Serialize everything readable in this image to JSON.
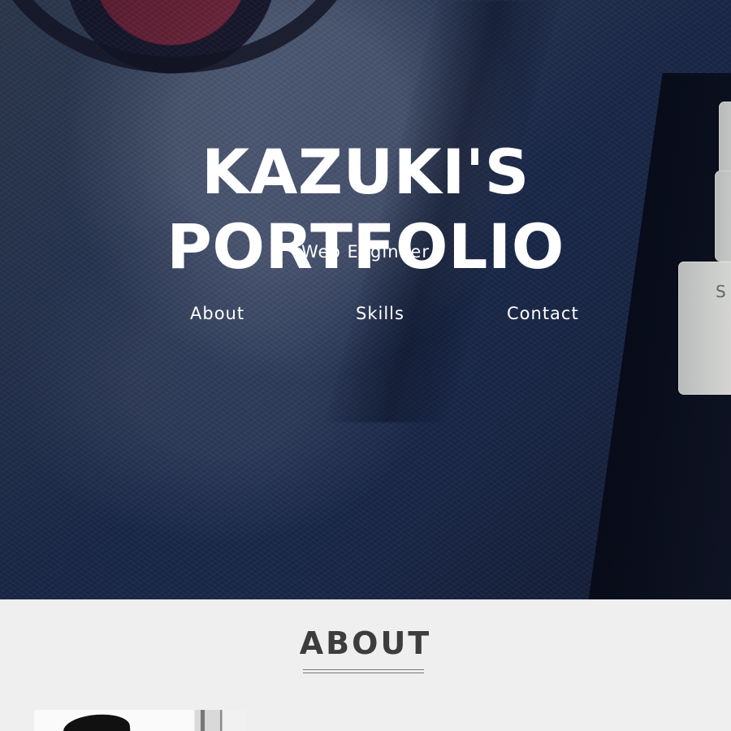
{
  "hero": {
    "title": "KAZUKI'S PORTFOLIO",
    "subtitle": "Web Engineer",
    "background_description": "dark blue textured background with keyboard keys"
  },
  "navigation": {
    "items": [
      {
        "label": "About"
      },
      {
        "label": "Skills"
      },
      {
        "label": "Contact"
      }
    ]
  },
  "about": {
    "title": "ABOUT",
    "photo_alt": "profile photo"
  },
  "visual": {
    "hero_text_color": "#ffffff",
    "section_background": "#efeff0",
    "heading_color": "#3d3d3d",
    "divider_color": "#777777",
    "keyboard_key_letter": "S"
  }
}
